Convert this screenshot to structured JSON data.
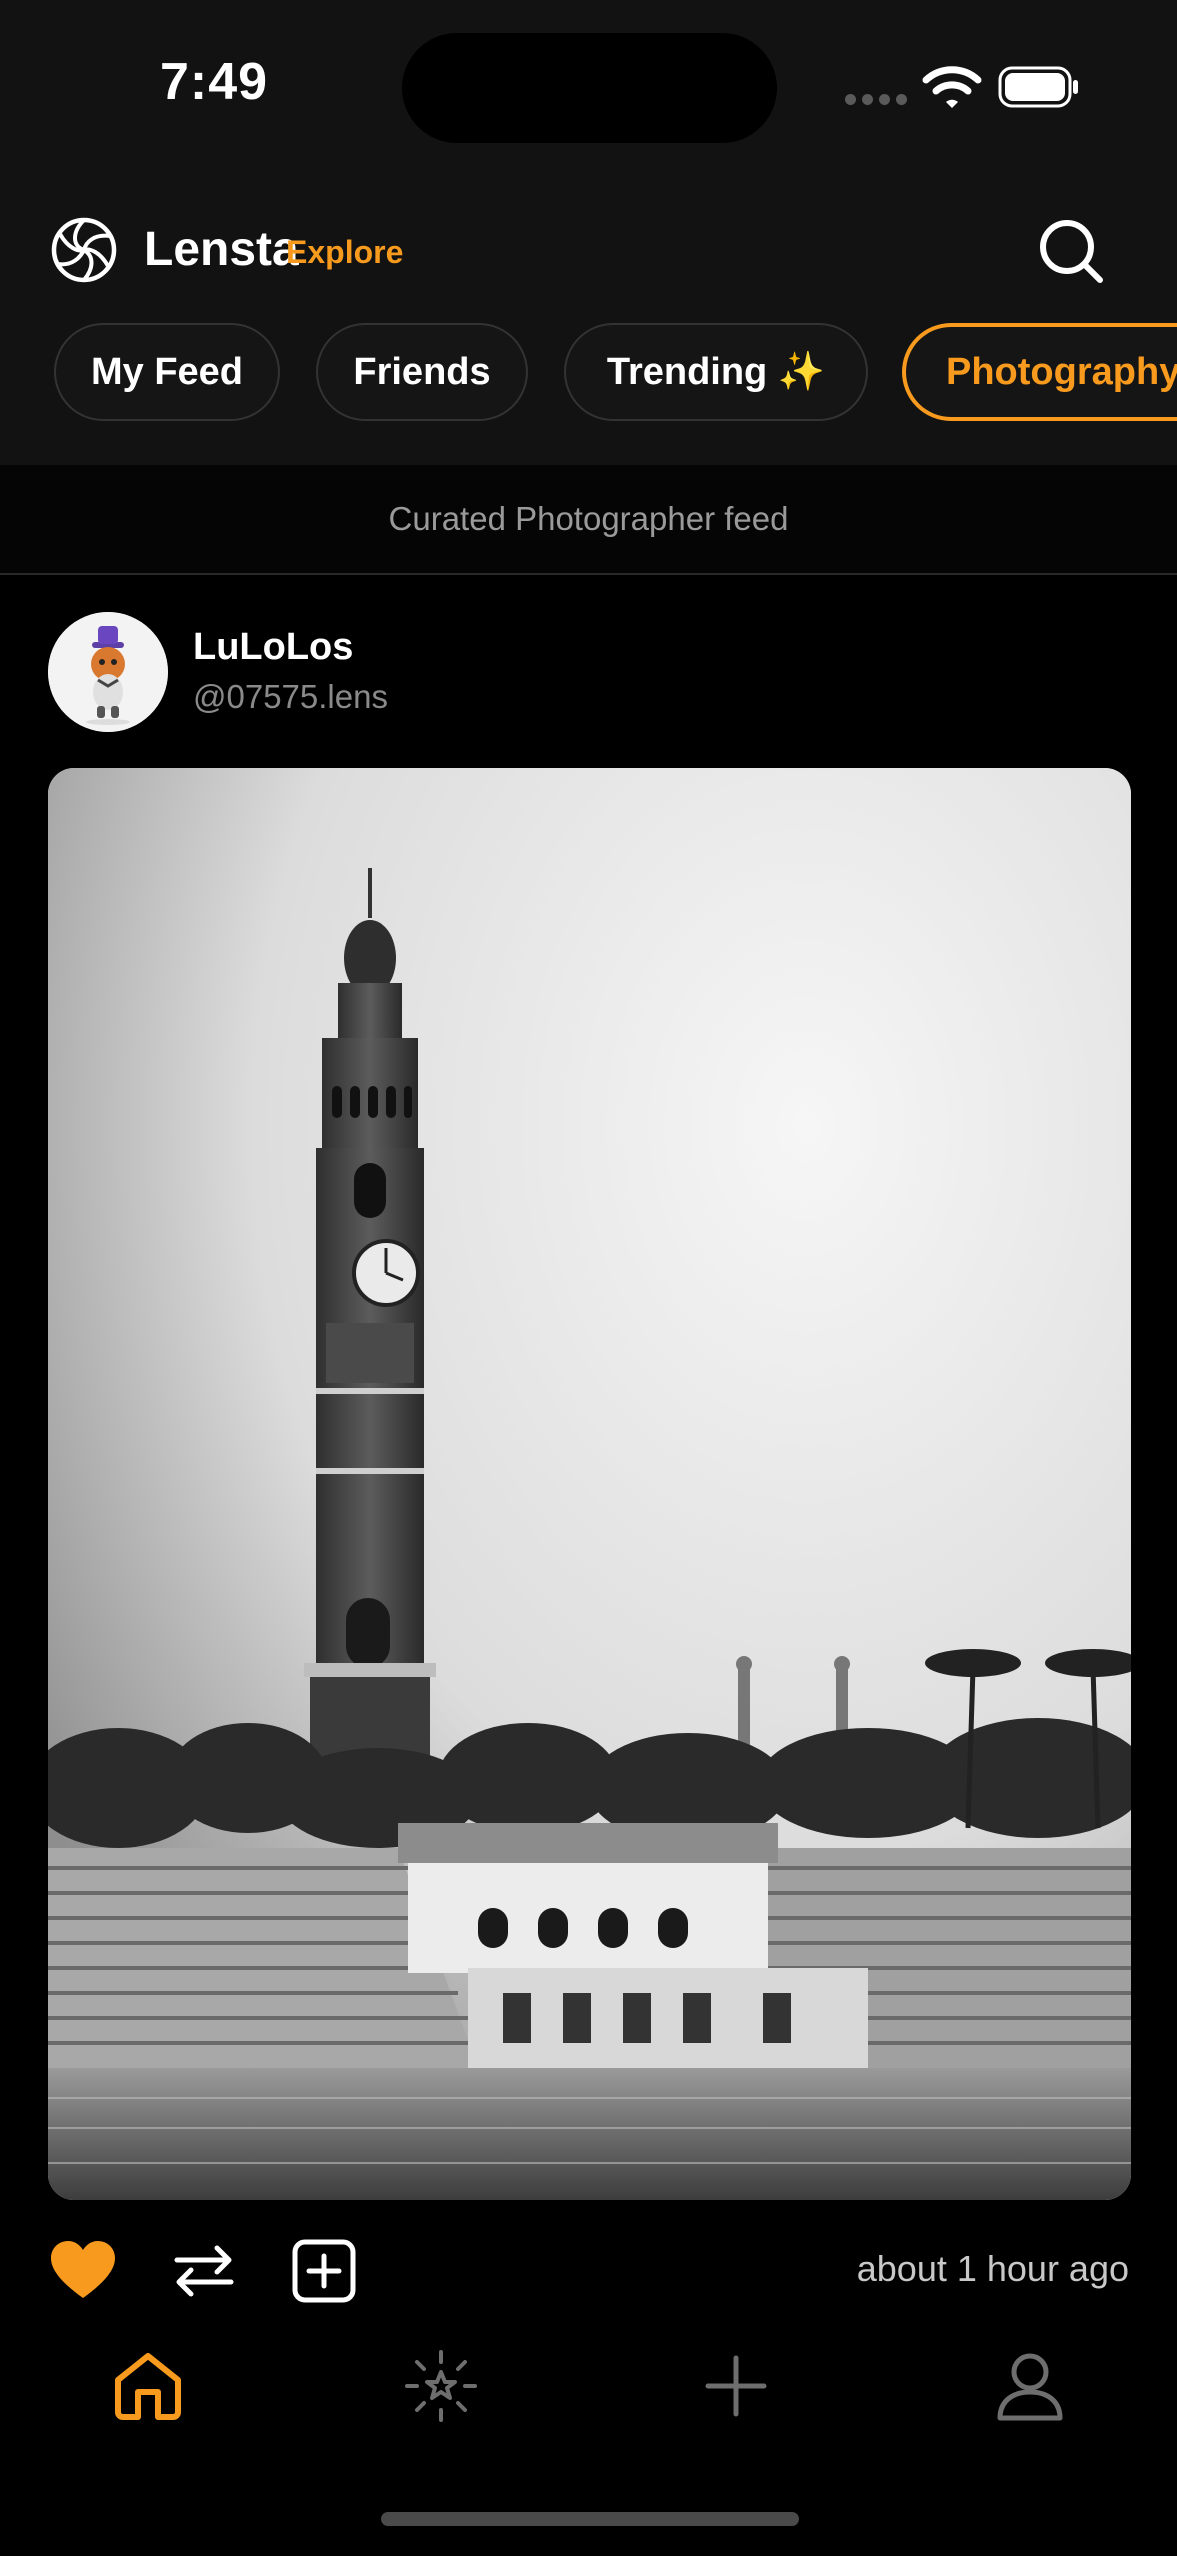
{
  "status_bar": {
    "time": "7:49"
  },
  "header": {
    "brand": "Lensta",
    "section": "Explore"
  },
  "tabs": [
    {
      "label": "My Feed"
    },
    {
      "label": "Friends"
    },
    {
      "label": "Trending ✨"
    },
    {
      "label": "Photography"
    }
  ],
  "active_tab": "Photography",
  "feed_caption": "Curated Photographer feed",
  "post": {
    "author_name": "LuLoLos",
    "author_handle": "@07575.lens",
    "timestamp": "about 1 hour ago",
    "liked": true
  },
  "colors": {
    "accent": "#f79a1d",
    "background": "#000000",
    "header": "#121212"
  },
  "icons": [
    "lensta-logo-icon",
    "search-icon",
    "heart-icon",
    "repost-icon",
    "collect-icon",
    "home-icon",
    "explore-icon",
    "plus-icon",
    "profile-icon"
  ]
}
